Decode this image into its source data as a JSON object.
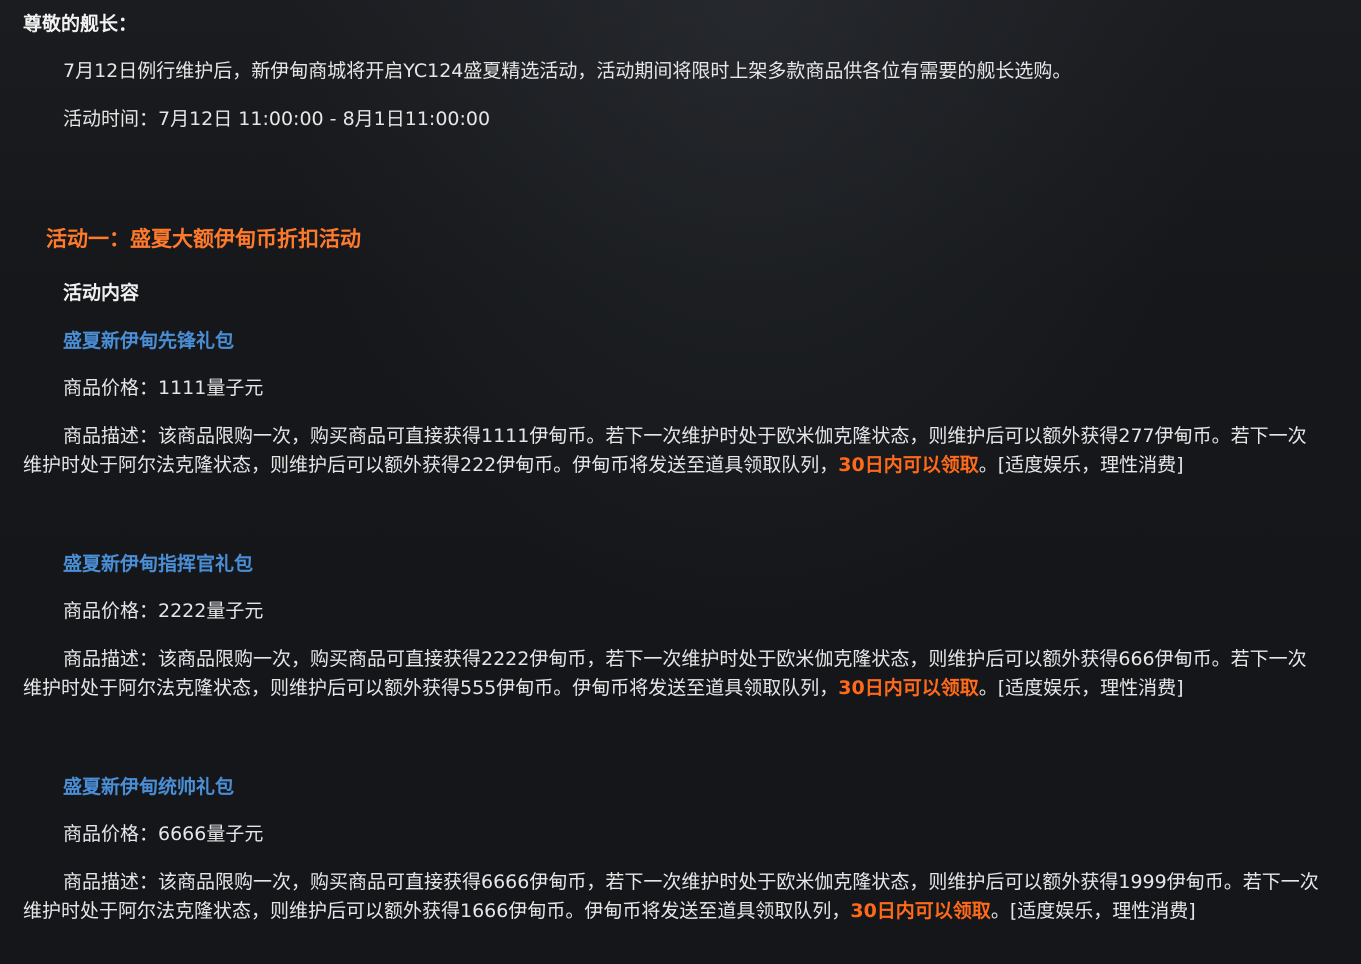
{
  "greeting": "尊敬的舰长：",
  "intro": "7月12日例行维护后，新伊甸商城将开启YC124盛夏精选活动，活动期间将限时上架多款商品供各位有需要的舰长选购。",
  "time": "活动时间：7月12日 11:00:00 - 8月1日11:00:00",
  "section": {
    "title": "活动一：盛夏大额伊甸币折扣活动",
    "content_heading": "活动内容"
  },
  "items": [
    {
      "name": "盛夏新伊甸先锋礼包",
      "price": "商品价格：1111量子元",
      "desc_a": "商品描述：该商品限购一次，购买商品可直接获得1111伊甸币。若下一次维护时处于欧米伽克隆状态，则维护后可以额外获得277伊甸币。若下一次维护时处于阿尔法克隆状态，则维护后可以额外获得222伊甸币。伊甸币将发送至道具领取队列，",
      "desc_highlight": "30日内可以领取",
      "desc_b": "。[适度娱乐，理性消费]"
    },
    {
      "name": "盛夏新伊甸指挥官礼包",
      "price": "商品价格：2222量子元",
      "desc_a": "商品描述：该商品限购一次，购买商品可直接获得2222伊甸币，若下一次维护时处于欧米伽克隆状态，则维护后可以额外获得666伊甸币。若下一次维护时处于阿尔法克隆状态，则维护后可以额外获得555伊甸币。伊甸币将发送至道具领取队列，",
      "desc_highlight": "30日内可以领取",
      "desc_b": "。[适度娱乐，理性消费]"
    },
    {
      "name": "盛夏新伊甸统帅礼包",
      "price": "商品价格：6666量子元",
      "desc_a": "商品描述：该商品限购一次，购买商品可直接获得6666伊甸币，若下一次维护时处于欧米伽克隆状态，则维护后可以额外获得1999伊甸币。若下一次维护时处于阿尔法克隆状态，则维护后可以额外获得1666伊甸币。伊甸币将发送至道具领取队列，",
      "desc_highlight": "30日内可以领取",
      "desc_b": "。[适度娱乐，理性消费]"
    }
  ],
  "colors": {
    "background": "#15171a",
    "accent_orange": "#ff7a2b",
    "item_blue": "#4a8ed6",
    "highlight": "#ff6a1a"
  }
}
